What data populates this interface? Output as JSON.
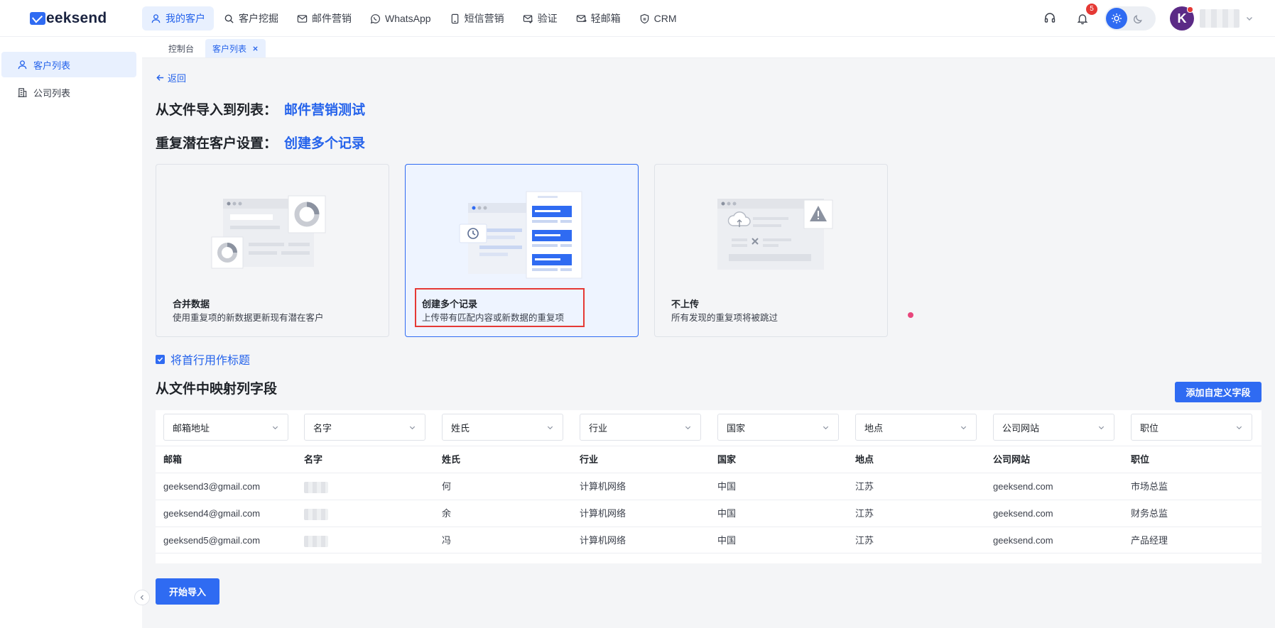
{
  "brand": {
    "logo_text": "eeksend"
  },
  "nav": {
    "items": [
      {
        "label": "我的客户",
        "icon": "user-icon"
      },
      {
        "label": "客户挖掘",
        "icon": "search-icon"
      },
      {
        "label": "邮件营销",
        "icon": "mail-icon"
      },
      {
        "label": "WhatsApp",
        "icon": "whatsapp-icon"
      },
      {
        "label": "短信营销",
        "icon": "phone-icon"
      },
      {
        "label": "验证",
        "icon": "mail-check-icon"
      },
      {
        "label": "轻邮箱",
        "icon": "mail-send-icon"
      },
      {
        "label": "CRM",
        "icon": "crm-icon"
      }
    ]
  },
  "header": {
    "notification_count": "5",
    "avatar_letter": "K"
  },
  "tabs": [
    {
      "label": "控制台"
    },
    {
      "label": "客户列表"
    }
  ],
  "sidebar": {
    "items": [
      {
        "label": "客户列表"
      },
      {
        "label": "公司列表"
      }
    ]
  },
  "main": {
    "back_label": "返回",
    "import_label": "从文件导入到列表：",
    "import_value": "邮件营销测试",
    "dup_label": "重复潜在客户设置：",
    "dup_value": "创建多个记录",
    "options": [
      {
        "title": "合并数据",
        "desc": "使用重复项的新数据更新现有潜在客户"
      },
      {
        "title": "创建多个记录",
        "desc": "上传带有匹配内容或新数据的重复项"
      },
      {
        "title": "不上传",
        "desc": "所有发现的重复项将被跳过"
      }
    ],
    "first_row_header_label": "将首行用作标题",
    "mapping_title": "从文件中映射列字段",
    "add_field_label": "添加自定义字段",
    "start_import_label": "开始导入"
  },
  "mapping": {
    "selects": [
      "邮箱地址",
      "名字",
      "姓氏",
      "行业",
      "国家",
      "地点",
      "公司网站",
      "职位"
    ],
    "headers": [
      "邮箱",
      "名字",
      "姓氏",
      "行业",
      "国家",
      "地点",
      "公司网站",
      "职位"
    ],
    "rows": [
      [
        "geeksend3@gmail.com",
        "",
        "何",
        "计算机网络",
        "中国",
        "江苏",
        "geeksend.com",
        "市场总监"
      ],
      [
        "geeksend4@gmail.com",
        "",
        "余",
        "计算机网络",
        "中国",
        "江苏",
        "geeksend.com",
        "财务总监"
      ],
      [
        "geeksend5@gmail.com",
        "",
        "冯",
        "计算机网络",
        "中国",
        "江苏",
        "geeksend.com",
        "产品经理"
      ]
    ]
  },
  "colors": {
    "accent": "#2f6bf2",
    "highlight": "#e53935"
  }
}
